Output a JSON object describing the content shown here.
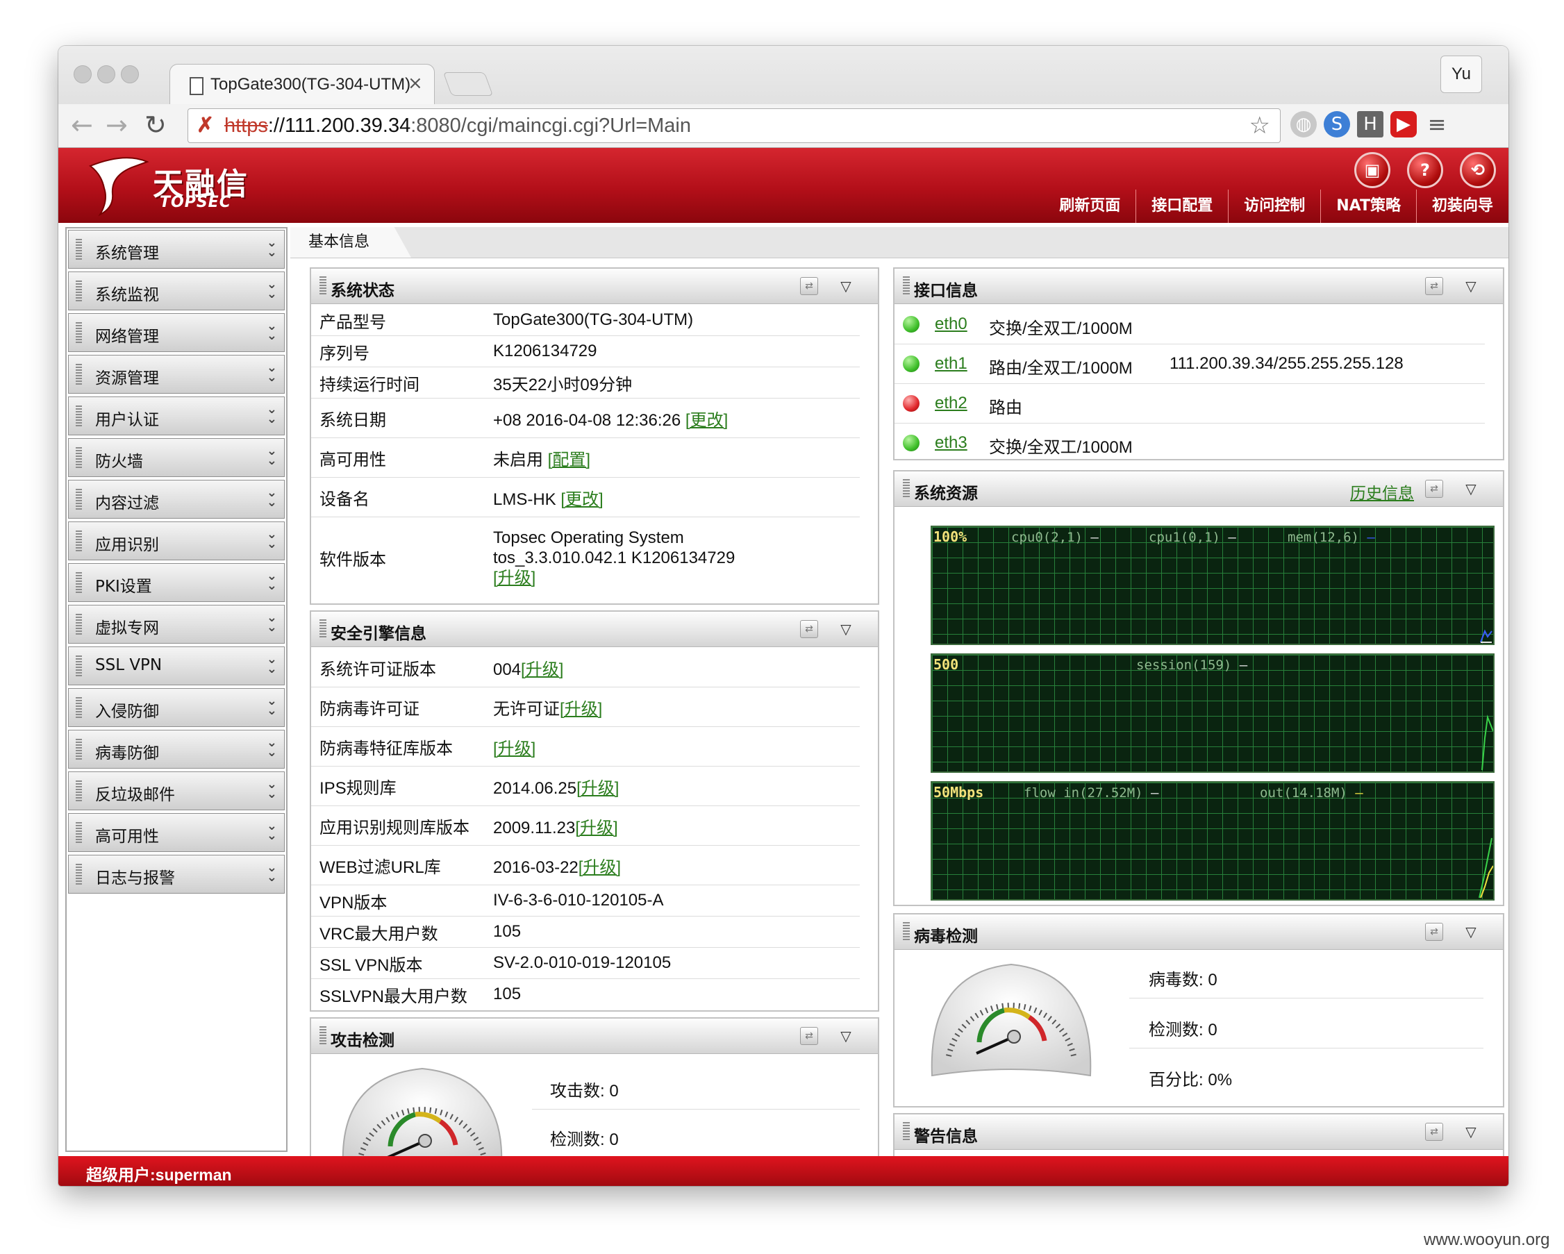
{
  "browser": {
    "tab_title": "TopGate300(TG-304-UTM)",
    "close_glyph": "×",
    "user_button": "Yu",
    "url_protocol": "https",
    "url_host": "://111.200.39.34",
    "url_path": ":8080/cgi/maincgi.cgi?Url=Main"
  },
  "header": {
    "brand": "天融信",
    "brand_sub": "TOPSEC",
    "icons": [
      "save-icon",
      "help-icon",
      "logout-icon"
    ],
    "nav": [
      "刷新页面",
      "接口配置",
      "访问控制",
      "NAT策略",
      "初装向导"
    ]
  },
  "sidebar": {
    "items": [
      "系统管理",
      "系统监视",
      "网络管理",
      "资源管理",
      "用户认证",
      "防火墙",
      "内容过滤",
      "应用识别",
      "PKI设置",
      "虚拟专网",
      "SSL VPN",
      "入侵防御",
      "病毒防御",
      "反垃圾邮件",
      "高可用性",
      "日志与报警"
    ]
  },
  "content_tab": "基本信息",
  "system_status": {
    "title": "系统状态",
    "rows": [
      {
        "k": "产品型号",
        "v": "TopGate300(TG-304-UTM)",
        "link": ""
      },
      {
        "k": "序列号",
        "v": "K1206134729",
        "link": ""
      },
      {
        "k": "持续运行时间",
        "v": "35天22小时09分钟",
        "link": ""
      },
      {
        "k": "系统日期",
        "v": "+08 2016-04-08 12:36:26 ",
        "link": "[更改]"
      },
      {
        "k": "高可用性",
        "v": "未启用 ",
        "link": "[配置]"
      },
      {
        "k": "设备名",
        "v": "LMS-HK ",
        "link": "[更改]"
      },
      {
        "k": "软件版本",
        "v1": "Topsec Operating System",
        "v2": "tos_3.3.010.042.1 K1206134729",
        "link": "[升级]"
      }
    ]
  },
  "security_engine": {
    "title": "安全引擎信息",
    "rows": [
      {
        "k": "系统许可证版本",
        "v": "004",
        "link": "[升级]"
      },
      {
        "k": "防病毒许可证",
        "v": "无许可证",
        "link": "[升级]"
      },
      {
        "k": "防病毒特征库版本",
        "v": "",
        "link": "[升级]"
      },
      {
        "k": "IPS规则库",
        "v": "2014.06.25",
        "link": "[升级]"
      },
      {
        "k": "应用识别规则库版本",
        "v": "2009.11.23",
        "link": "[升级]"
      },
      {
        "k": "WEB过滤URL库",
        "v": "2016-03-22",
        "link": "[升级]"
      },
      {
        "k": "VPN版本",
        "v": "IV-6-3-6-010-120105-A",
        "link": ""
      },
      {
        "k": "VRC最大用户数",
        "v": "105",
        "link": ""
      },
      {
        "k": "SSL VPN版本",
        "v": "SV-2.0-010-019-120105",
        "link": ""
      },
      {
        "k": "SSLVPN最大用户数",
        "v": "105",
        "link": ""
      }
    ]
  },
  "attack_detection": {
    "title": "攻击检测",
    "attack_label": "攻击数:",
    "attack_value": "0",
    "detect_label": "检测数:",
    "detect_value": "0"
  },
  "interfaces": {
    "title": "接口信息",
    "rows": [
      {
        "name": "eth0",
        "mode": "交换/全双工/1000M",
        "ip": "",
        "status": "up"
      },
      {
        "name": "eth1",
        "mode": "路由/全双工/1000M",
        "ip": "111.200.39.34/255.255.255.128",
        "status": "up"
      },
      {
        "name": "eth2",
        "mode": "路由",
        "ip": "",
        "status": "down"
      },
      {
        "name": "eth3",
        "mode": "交换/全双工/1000M",
        "ip": "",
        "status": "up"
      }
    ],
    "colors": {
      "up": "#3fbf2a",
      "down": "#e0262a"
    }
  },
  "system_resources": {
    "title": "系统资源",
    "history_link": "历史信息",
    "graphs": [
      {
        "scale": "100%",
        "legends": [
          "cpu0(2,1)",
          "cpu1(0,1)",
          "mem(12,6)"
        ]
      },
      {
        "scale": "500",
        "legends": [
          "session(159)"
        ]
      },
      {
        "scale": "50Mbps",
        "legends": [
          "flow in(27.52M)",
          "out(14.18M)"
        ]
      }
    ],
    "legend_colors": [
      "#e8e8e8",
      "#e8e8e8",
      "#3a5cff",
      "#e8e8e8",
      "#e8e8e8",
      "#f0e040"
    ]
  },
  "virus_detection": {
    "title": "病毒检测",
    "virus_label": "病毒数:",
    "virus_value": "0",
    "detect_label": "检测数:",
    "detect_value": "0",
    "percent_label": "百分比:",
    "percent_value": "0%"
  },
  "alerts": {
    "title": "警告信息"
  },
  "footer": {
    "user": "超级用户:superman"
  },
  "watermark": "www.wooyun.org"
}
